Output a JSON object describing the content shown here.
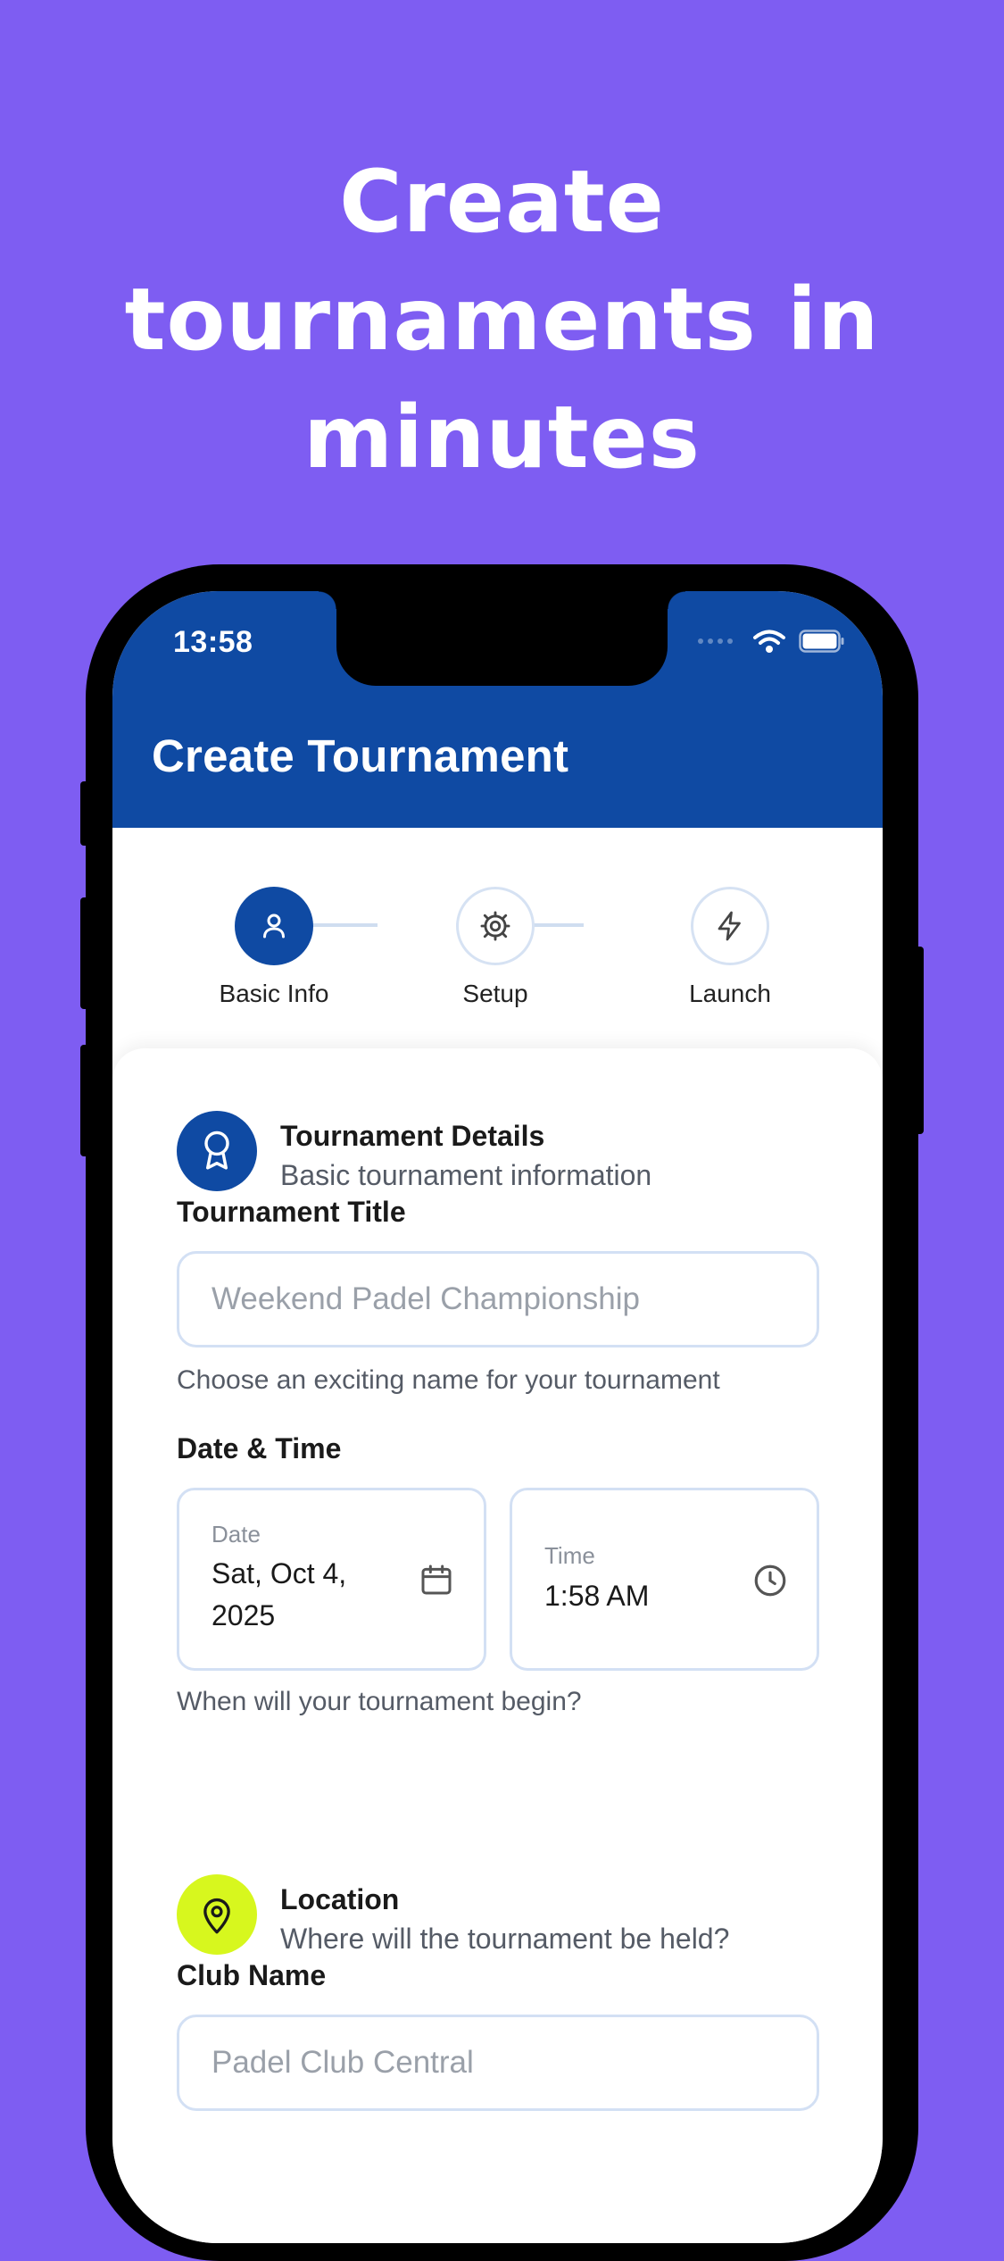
{
  "headline": [
    "Create",
    "tournaments in",
    "minutes"
  ],
  "status_bar": {
    "time": "13:58"
  },
  "app_bar": {
    "title": "Create Tournament"
  },
  "stepper": {
    "steps": [
      {
        "label": "Basic Info",
        "icon": "person-icon",
        "active": true
      },
      {
        "label": "Setup",
        "icon": "gear-icon",
        "active": false
      },
      {
        "label": "Launch",
        "icon": "lightning-icon",
        "active": false
      }
    ]
  },
  "details_section": {
    "title": "Tournament Details",
    "subtitle": "Basic tournament information",
    "icon": "award-ribbon-icon"
  },
  "tournament_title": {
    "label": "Tournament Title",
    "placeholder": "Weekend Padel Championship",
    "value": "",
    "helper": "Choose an exciting name for your tournament"
  },
  "date_time": {
    "label": "Date & Time",
    "date_label": "Date",
    "date_value_line1": "Sat, Oct 4,",
    "date_value_line2": "2025",
    "time_label": "Time",
    "time_value": "1:58 AM",
    "helper": "When will your tournament begin?"
  },
  "location_section": {
    "title": "Location",
    "subtitle": "Where will the tournament be held?",
    "icon": "map-pin-icon"
  },
  "club_name": {
    "label": "Club Name",
    "placeholder": "Padel Club Central",
    "value": ""
  },
  "colors": {
    "background": "#7E5DF2",
    "primary": "#0F4AA3",
    "accent_lime": "#D7F71E",
    "input_border": "#D3E0F4"
  }
}
